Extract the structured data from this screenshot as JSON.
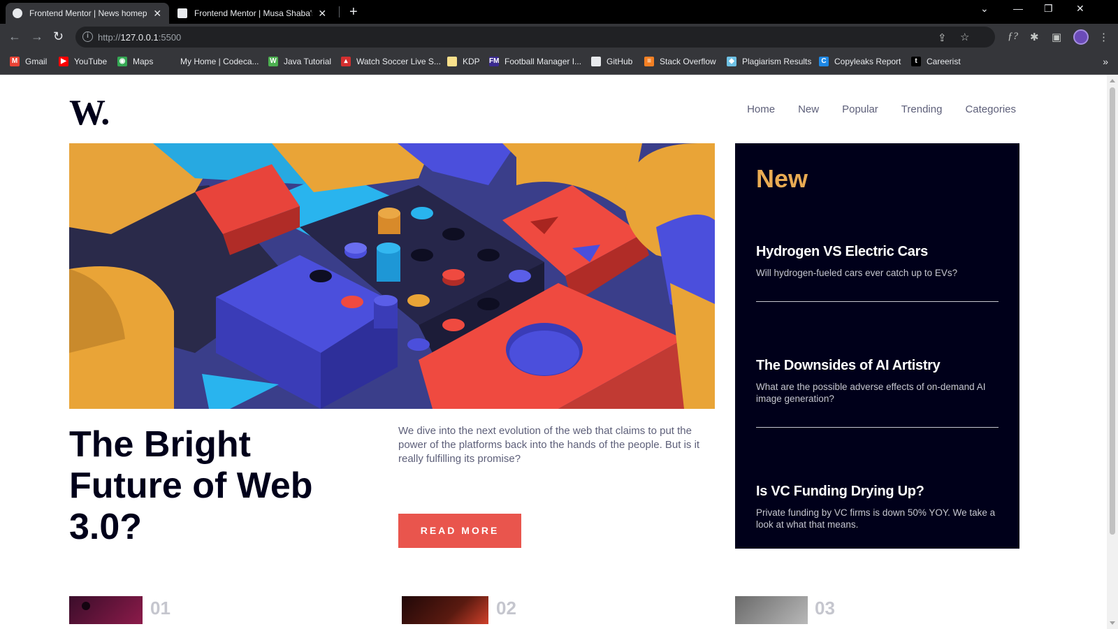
{
  "browser": {
    "tabs": [
      {
        "title": "Frontend Mentor | News homepage",
        "active": true
      },
      {
        "title": "Frontend Mentor | Musa Shaba's",
        "active": false
      }
    ],
    "new_tab": "+",
    "url_host": "http://",
    "url_main": "127.0.0.1",
    "url_port": ":5500",
    "bookmarks": [
      {
        "label": "Gmail",
        "color": "#ea4335",
        "glyph": "M"
      },
      {
        "label": "YouTube",
        "color": "#ff0000",
        "glyph": "▶"
      },
      {
        "label": "Maps",
        "color": "#34a853",
        "glyph": "◉"
      },
      {
        "label": "My Home | Codeca...",
        "color": "#35363a",
        "glyph": ""
      },
      {
        "label": "Java Tutorial",
        "color": "#4caf50",
        "glyph": "W"
      },
      {
        "label": "Watch Soccer Live S...",
        "color": "#d32f2f",
        "glyph": "▴"
      },
      {
        "label": "KDP",
        "color": "#f9e08b",
        "glyph": ""
      },
      {
        "label": "Football Manager I...",
        "color": "#3a2a8f",
        "glyph": "FM"
      },
      {
        "label": "GitHub",
        "color": "#e8eaed",
        "glyph": ""
      },
      {
        "label": "Stack Overflow",
        "color": "#f48024",
        "glyph": "≡"
      },
      {
        "label": "Plagiarism Results",
        "color": "#6ec1e4",
        "glyph": "◆"
      },
      {
        "label": "Copyleaks Report",
        "color": "#1e88e5",
        "glyph": "C"
      },
      {
        "label": "Careerist",
        "color": "#000000",
        "glyph": "t"
      }
    ]
  },
  "site": {
    "logo": "W.",
    "nav": [
      "Home",
      "New",
      "Popular",
      "Trending",
      "Categories"
    ]
  },
  "hero": {
    "title": "The Bright Future of Web 3.0?",
    "lead": "We dive into the next evolution of the web that claims to put the power of the platforms back into the hands of the people. But is it really fulfilling its promise?",
    "button": "READ MORE"
  },
  "sidebar": {
    "heading": "New",
    "items": [
      {
        "title": "Hydrogen VS Electric Cars",
        "text": "Will hydrogen-fueled cars ever catch up to EVs?"
      },
      {
        "title": "The Downsides of AI Artistry",
        "text": "What are the possible adverse effects of on-demand AI image generation?"
      },
      {
        "title": "Is VC Funding Drying Up?",
        "text": "Private funding by VC firms is down 50% YOY. We take a look at what that means."
      }
    ]
  },
  "bottom": {
    "numbers": [
      "01",
      "02",
      "03"
    ]
  },
  "colors": {
    "accent_red": "#e9554d",
    "accent_orange": "#e9ab53",
    "dark_navy": "#00001a",
    "grayish_blue": "#5d5f79"
  }
}
